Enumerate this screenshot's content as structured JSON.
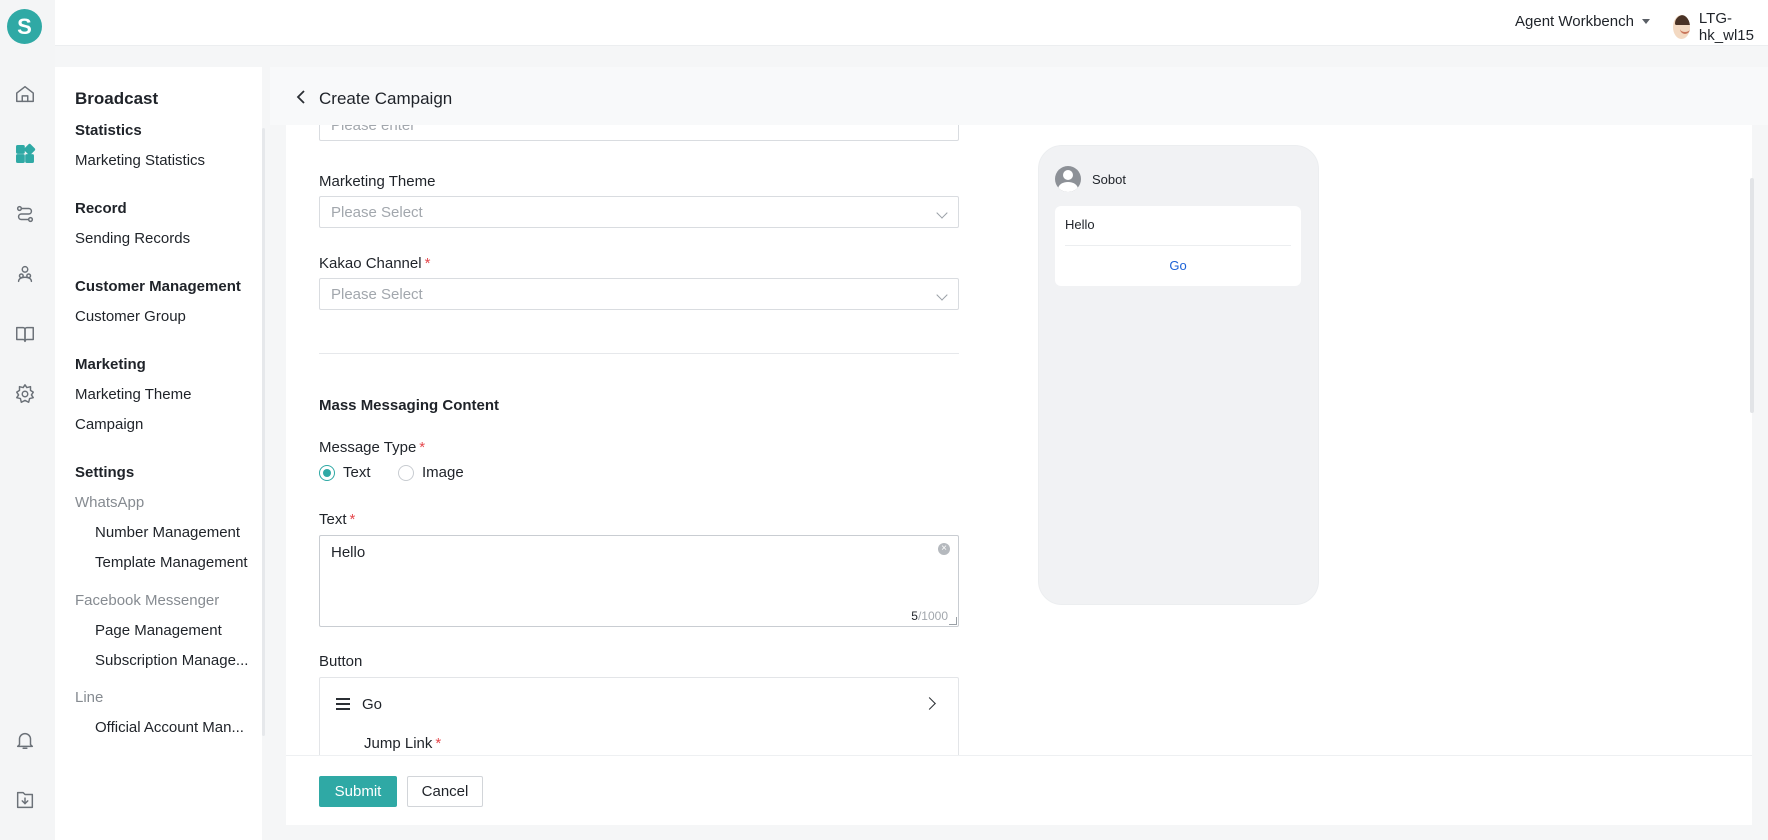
{
  "app": {
    "logo_letter": "S"
  },
  "rail": [
    "home-icon",
    "dashboard-icon",
    "routing-icon",
    "people-icon",
    "book-icon",
    "settings-icon",
    "bell-icon",
    "download-icon"
  ],
  "header": {
    "workbench": "Agent Workbench",
    "user": "LTG-hk_wl15"
  },
  "nav": {
    "title": "Broadcast",
    "statistics": {
      "label": "Statistics",
      "items": [
        "Marketing Statistics"
      ]
    },
    "record": {
      "label": "Record",
      "items": [
        "Sending Records"
      ]
    },
    "customer": {
      "label": "Customer Management",
      "items": [
        "Customer Group"
      ]
    },
    "marketing": {
      "label": "Marketing",
      "items": [
        "Marketing Theme",
        "Campaign"
      ]
    },
    "settings": {
      "label": "Settings",
      "whatsapp": {
        "label": "WhatsApp",
        "items": [
          "Number Management",
          "Template Management"
        ]
      },
      "facebook": {
        "label": "Facebook Messenger",
        "items": [
          "Page Management",
          "Subscription Manage..."
        ]
      },
      "line": {
        "label": "Line",
        "items": [
          "Official Account Man..."
        ]
      }
    }
  },
  "page": {
    "title": "Create Campaign"
  },
  "form": {
    "top_field_placeholder": "Please enter",
    "marketing_theme": {
      "label": "Marketing Theme",
      "placeholder": "Please Select"
    },
    "kakao_channel": {
      "label": "Kakao Channel",
      "required": "*",
      "placeholder": "Please Select"
    },
    "section_title": "Mass Messaging Content",
    "message_type": {
      "label": "Message Type",
      "required": "*",
      "options": [
        "Text",
        "Image"
      ],
      "selected": "Text"
    },
    "text": {
      "label": "Text",
      "required": "*",
      "value": "Hello",
      "count": "5",
      "max": "/1000"
    },
    "button": {
      "label": "Button",
      "name": "Go",
      "jump_label": "Jump Link",
      "required": "*"
    }
  },
  "preview": {
    "bot_name": "Sobot",
    "message": "Hello",
    "button": "Go"
  },
  "footer": {
    "submit": "Submit",
    "cancel": "Cancel"
  },
  "colors": {
    "accent": "#2fa9a5",
    "link": "#1c62d6",
    "required": "#e5484d"
  }
}
